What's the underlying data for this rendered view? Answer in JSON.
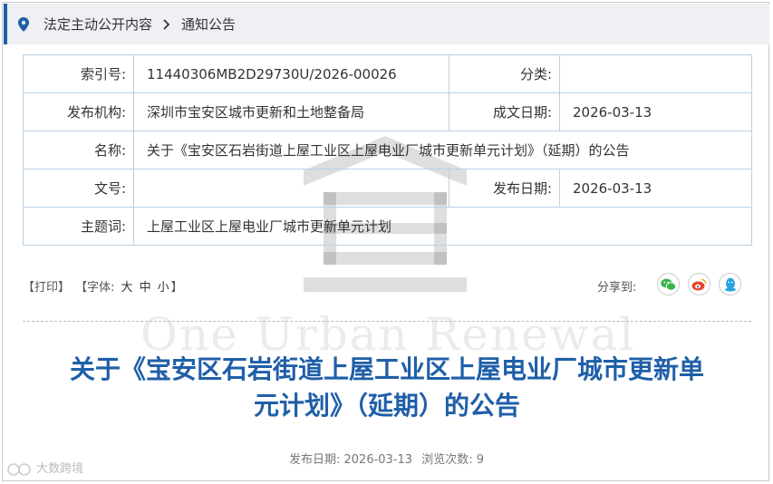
{
  "breadcrumb": {
    "items": [
      "法定主动公开内容",
      "通知公告"
    ],
    "separator": ">"
  },
  "meta": {
    "index_label": "索引号:",
    "index_value": "11440306MB2D29730U/2026-00026",
    "category_label": "分类:",
    "category_value": "",
    "publisher_label": "发布机构:",
    "publisher_value": "深圳市宝安区城市更新和土地整备局",
    "written_date_label": "成文日期:",
    "written_date_value": "2026-03-13",
    "name_label": "名称:",
    "name_value": "关于《宝安区石岩街道上屋工业区上屋电业厂城市更新单元计划》（延期）的公告",
    "doc_no_label": "文号:",
    "doc_no_value": "",
    "publish_date_label": "发布日期:",
    "publish_date_value": "2026-03-13",
    "subject_label": "主题词:",
    "subject_value": "上屋工业区上屋电业厂城市更新单元计划"
  },
  "toolbar": {
    "print": "【打印】",
    "font_prefix": "【字体:",
    "size_large": "大",
    "size_medium": "中",
    "size_small": "小",
    "font_suffix": "】",
    "share_label": "分享到:"
  },
  "article": {
    "title_line1": "关于《宝安区石岩街道上屋工业区上屋电业厂城市更新单",
    "title_line2": "元计划》（延期）的公告",
    "publish_label": "发布日期:",
    "publish_date": "2026-03-13",
    "views_label": "浏览次数:",
    "views": "9"
  },
  "watermark": {
    "text": "One Urban Renewal"
  },
  "corner_logo": {
    "text": "大数跨境"
  },
  "colors": {
    "accent": "#1f5fa8",
    "table_border": "#b8d0e6",
    "wechat": "#3bb54a",
    "weibo": "#e6452f",
    "qq": "#2aa4e3"
  },
  "icons": [
    "pin-icon",
    "chevron-right-icon",
    "wechat-icon",
    "weibo-icon",
    "qq-icon"
  ]
}
